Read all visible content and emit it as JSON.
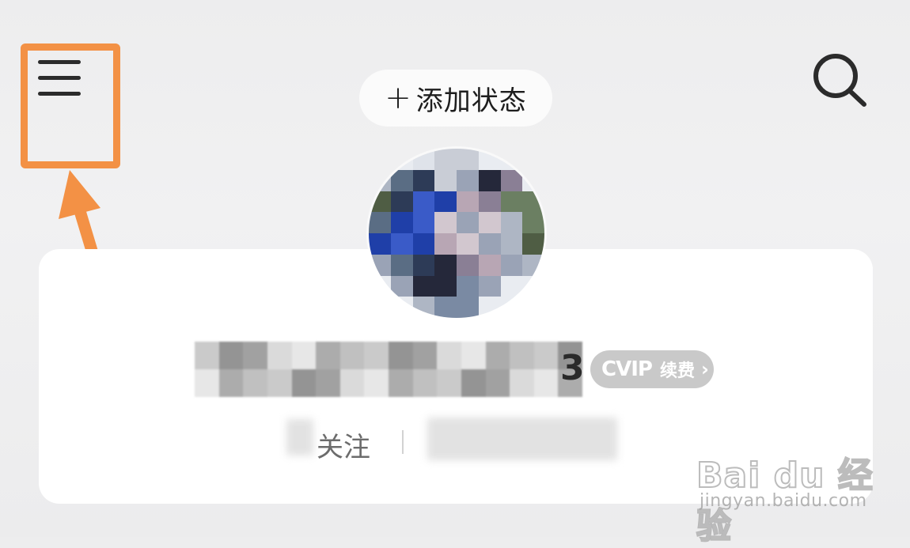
{
  "header": {
    "menu_icon": "hamburger-menu-icon",
    "search_icon": "search-icon",
    "status_button": {
      "icon": "plus-icon",
      "plus_glyph": "+",
      "label": "添加状态"
    }
  },
  "profile": {
    "name_suffix": "3",
    "vip_badge": {
      "logo": "CVIP",
      "label": "续费",
      "chevron": "›"
    },
    "stats": {
      "follow_label": "关注"
    }
  },
  "annotation": {
    "highlight_color": "#f39145"
  },
  "watermark": {
    "brand": "Bai du 经验",
    "url": "jingyan.baidu.com"
  }
}
